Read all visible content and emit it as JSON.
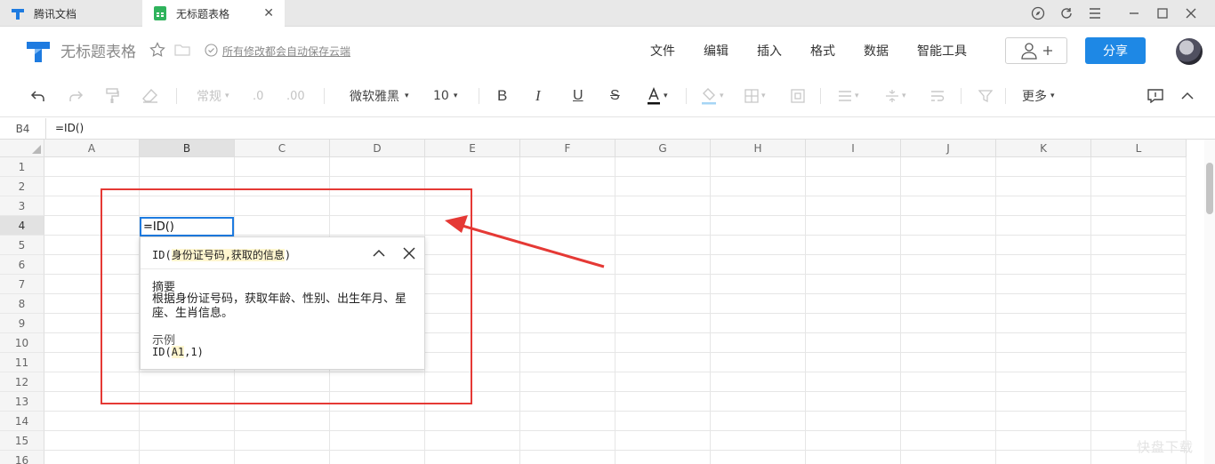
{
  "tabs": [
    {
      "label": "腾讯文档",
      "icon": "tencent-docs-logo-icon",
      "active": false
    },
    {
      "label": "无标题表格",
      "icon": "sheet-icon",
      "active": true
    }
  ],
  "window_controls": [
    "compass-icon",
    "refresh-icon",
    "hamburger-menu-icon",
    "minimize-icon",
    "maximize-icon",
    "close-icon"
  ],
  "header": {
    "doc_title": "无标题表格",
    "save_note": "所有修改都会自动保存云端",
    "menu": [
      "文件",
      "编辑",
      "插入",
      "格式",
      "数据",
      "智能工具"
    ],
    "share_label": "分享",
    "accent": "#1e88e5"
  },
  "toolbar": {
    "number_format": "常规",
    "font": "微软雅黑",
    "font_size": "10",
    "more_label": "更多"
  },
  "formula_bar": {
    "cell_ref": "B4",
    "formula": "=ID()"
  },
  "grid": {
    "columns": [
      "A",
      "B",
      "C",
      "D",
      "E",
      "F",
      "G",
      "H",
      "I",
      "J",
      "K",
      "L"
    ],
    "rows": [
      "1",
      "2",
      "3",
      "4",
      "5",
      "6",
      "7",
      "8",
      "9",
      "10",
      "11",
      "12",
      "13",
      "14",
      "15",
      "16"
    ],
    "active_cell_text": "=ID()"
  },
  "function_tip": {
    "name": "ID",
    "args": "身份证号码,获取的信息",
    "summary_label": "摘要",
    "summary_text": "根据身份证号码，获取年龄、性别、出生年月、星座、生肖信息。",
    "example_label": "示例",
    "example_fn": "ID",
    "example_ref": "A1",
    "example_rest": ",1)"
  },
  "annotation_color": "#e53935",
  "watermark": "快盘下载"
}
